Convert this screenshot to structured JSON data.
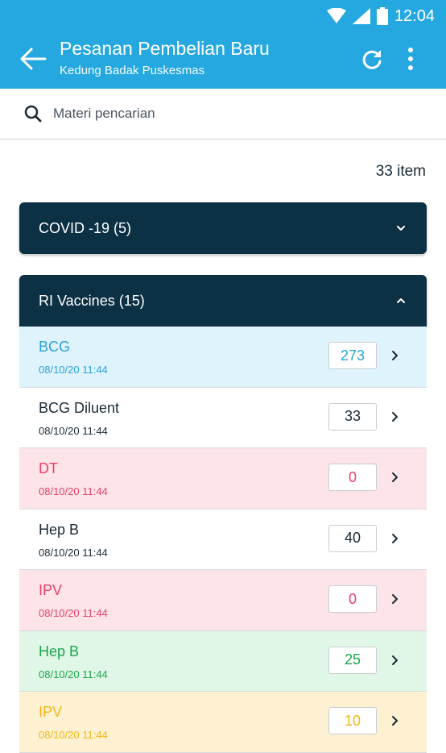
{
  "status_bar": {
    "time": "12:04"
  },
  "header": {
    "title": "Pesanan Pembelian Baru",
    "subtitle": "Kedung Badak Puskesmas",
    "colors": {
      "background": "#25a8e0",
      "foreground": "#ffffff"
    },
    "icons": [
      "back-arrow-icon",
      "refresh-icon",
      "more-vert-icon"
    ]
  },
  "search": {
    "placeholder": "Materi pencarian",
    "value": ""
  },
  "item_count": "33 item",
  "groups": [
    {
      "label": "COVID -19 (5)",
      "expanded": false
    },
    {
      "label": "RI Vaccines (15)",
      "expanded": true
    }
  ],
  "group_color": "#0d3144",
  "items": [
    {
      "name": "BCG",
      "date": "08/10/20 11:44",
      "qty": "273",
      "text_color": "#29a3d9",
      "bg": "#dff3fc"
    },
    {
      "name": "BCG Diluent",
      "date": "08/10/20 11:44",
      "qty": "33",
      "text_color": "#1a2a36",
      "bg": "#ffffff"
    },
    {
      "name": "DT",
      "date": "08/10/20 11:44",
      "qty": "0",
      "text_color": "#e8406a",
      "bg": "#fce4e9"
    },
    {
      "name": "Hep B",
      "date": "08/10/20 11:44",
      "qty": "40",
      "text_color": "#1a2a36",
      "bg": "#ffffff"
    },
    {
      "name": "IPV",
      "date": "08/10/20 11:44",
      "qty": "0",
      "text_color": "#e8406a",
      "bg": "#fce4e9"
    },
    {
      "name": "Hep B",
      "date": "08/10/20 11:44",
      "qty": "25",
      "text_color": "#1aa64a",
      "bg": "#e0f6e7"
    },
    {
      "name": "IPV",
      "date": "08/10/20 11:44",
      "qty": "10",
      "text_color": "#f2b619",
      "bg": "#fdf1d2"
    }
  ]
}
